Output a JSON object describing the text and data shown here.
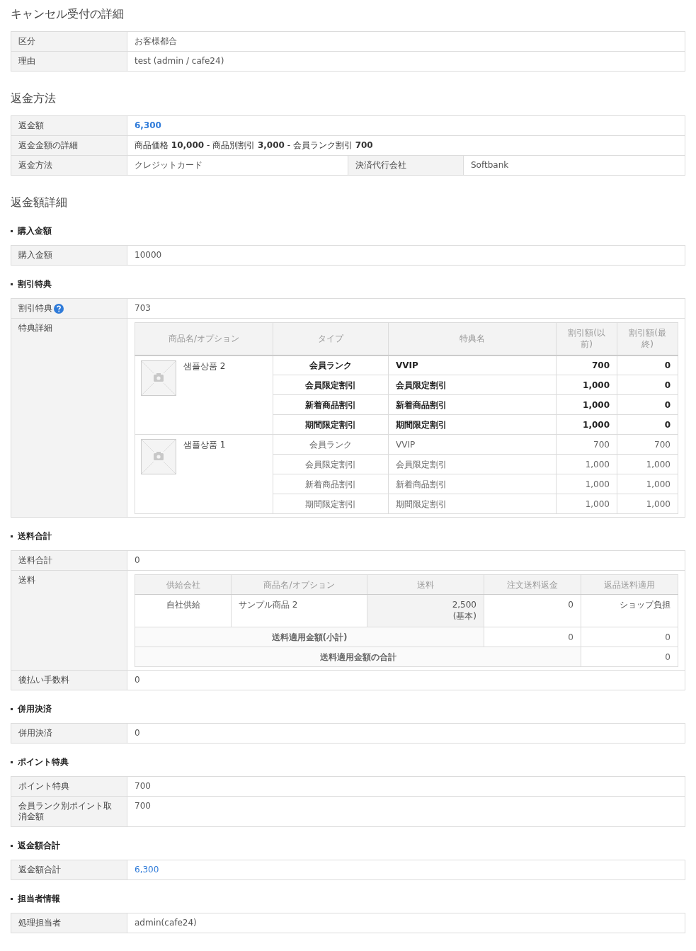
{
  "blocks": [
    {
      "kind": "title",
      "text": "キャンセル受付の詳細"
    },
    {
      "kind": "table",
      "rows": [
        {
          "kind": "text",
          "label": "区分",
          "value": "お客様都合"
        },
        {
          "kind": "text",
          "label": "理由",
          "value": "test (admin / cafe24)"
        }
      ]
    },
    {
      "kind": "title",
      "text": "返金方法"
    },
    {
      "kind": "table",
      "rows": [
        {
          "kind": "amount",
          "bold": true,
          "label": "返金額",
          "value": "6,300"
        },
        {
          "kind": "rich",
          "label": "返金金額の詳細",
          "value": "商品価格 **10,000** - 商品別割引 **3,000** - 会員ランク割引 **700**"
        },
        {
          "kind": "split",
          "label": "返金方法",
          "value": "クレジットカード",
          "label_2": "決済代行会社",
          "value_2": "Softbank"
        }
      ]
    },
    {
      "kind": "title",
      "text": "返金額詳細"
    },
    {
      "kind": "subtitle",
      "text": "購入金額"
    },
    {
      "kind": "table",
      "rows": [
        {
          "kind": "text",
          "label": "購入金額",
          "value": "10000"
        }
      ]
    },
    {
      "kind": "subtitle",
      "text": "割引特典"
    },
    {
      "kind": "table",
      "rows": [
        {
          "kind": "help",
          "label": "割引特典",
          "value": "703"
        },
        {
          "kind": "benefits",
          "label": "特典詳細",
          "columns": [
            "商品名/オプション",
            "タイプ",
            "特典名",
            "割引額(以前)",
            "割引額(最終)"
          ],
          "products": [
            {
              "name": "샘플상품 2",
              "bold": true,
              "items": [
                {
                  "type": "会員ランク",
                  "name": "VVIP",
                  "before": "700",
                  "final": "0"
                },
                {
                  "type": "会員限定割引",
                  "name": "会員限定割引",
                  "before": "1,000",
                  "final": "0"
                },
                {
                  "type": "新着商品割引",
                  "name": "新着商品割引",
                  "before": "1,000",
                  "final": "0"
                },
                {
                  "type": "期間限定割引",
                  "name": "期間限定割引",
                  "before": "1,000",
                  "final": "0"
                }
              ]
            },
            {
              "name": "샘플상품 1",
              "bold": false,
              "items": [
                {
                  "type": "会員ランク",
                  "name": "VVIP",
                  "before": "700",
                  "final": "700"
                },
                {
                  "type": "会員限定割引",
                  "name": "会員限定割引",
                  "before": "1,000",
                  "final": "1,000"
                },
                {
                  "type": "新着商品割引",
                  "name": "新着商品割引",
                  "before": "1,000",
                  "final": "1,000"
                },
                {
                  "type": "期間限定割引",
                  "name": "期間限定割引",
                  "before": "1,000",
                  "final": "1,000"
                }
              ]
            }
          ]
        }
      ]
    },
    {
      "kind": "subtitle",
      "text": "送料合計"
    },
    {
      "kind": "table",
      "rows": [
        {
          "kind": "text",
          "label": "送料合計",
          "value": "0"
        },
        {
          "kind": "shipping",
          "label": "送料",
          "columns": [
            "供給会社",
            "商品名/オプション",
            "送料",
            "注文送料返金",
            "返品送料適用"
          ],
          "items": [
            {
              "supplier": "自社供給",
              "product": "サンプル商品 2",
              "fee": "2,500",
              "fee_note": "(基本)",
              "order_refund": "0",
              "return_fee": "ショップ負担"
            }
          ],
          "subtotal": {
            "label": "送料適用金額(小計)",
            "order_refund": "0",
            "return_fee": "0"
          },
          "total": {
            "label": "送料適用金額の合計",
            "value": "0"
          }
        },
        {
          "kind": "text",
          "label": "後払い手数料",
          "value": "0"
        }
      ]
    },
    {
      "kind": "subtitle",
      "text": "併用決済"
    },
    {
      "kind": "table",
      "rows": [
        {
          "kind": "text",
          "label": "併用決済",
          "value": "0"
        }
      ]
    },
    {
      "kind": "subtitle",
      "text": "ポイント特典"
    },
    {
      "kind": "table",
      "rows": [
        {
          "kind": "text",
          "label": "ポイント特典",
          "value": "700"
        },
        {
          "kind": "text",
          "label": "会員ランク別ポイント取消金額",
          "value": "700"
        }
      ]
    },
    {
      "kind": "subtitle",
      "text": "返金額合計"
    },
    {
      "kind": "table",
      "rows": [
        {
          "kind": "amount",
          "bold": false,
          "label": "返金額合計",
          "value": "6,300"
        }
      ]
    },
    {
      "kind": "subtitle",
      "text": "担当者情報"
    },
    {
      "kind": "table",
      "rows": [
        {
          "kind": "text",
          "label": "処理担当者",
          "value": "admin(cafe24)"
        }
      ]
    }
  ]
}
